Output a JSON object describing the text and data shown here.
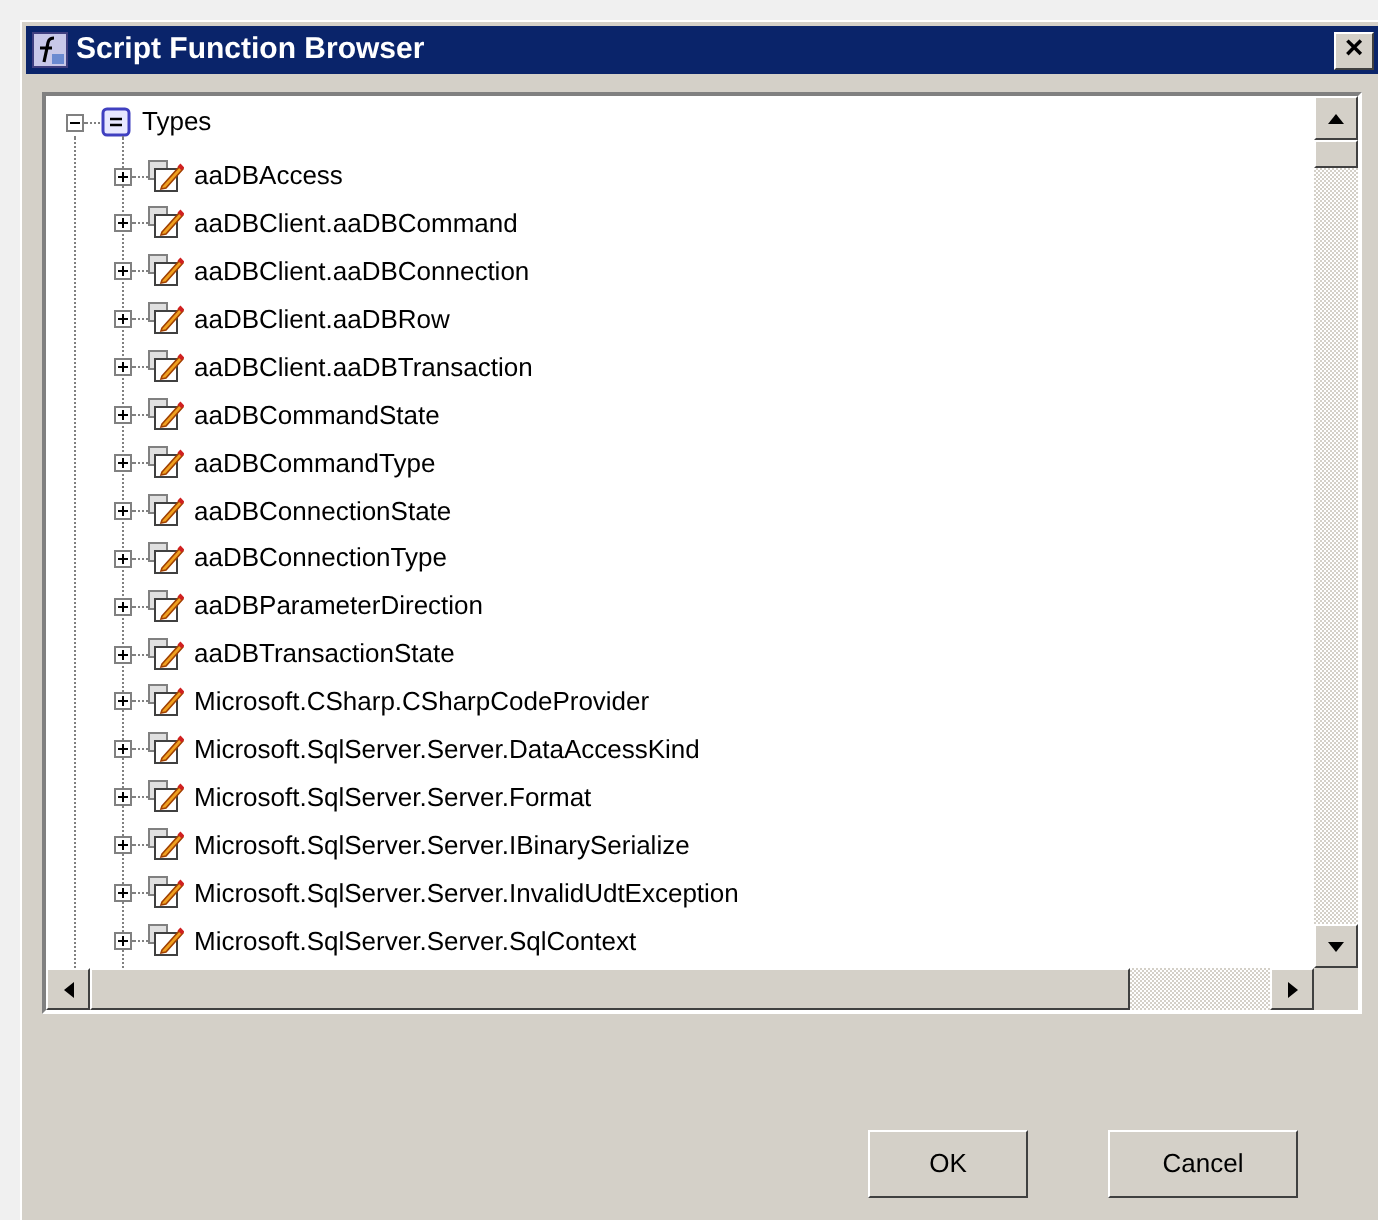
{
  "window": {
    "title": "Script Function Browser",
    "close": "×"
  },
  "tree": [
    {
      "label": "Types",
      "expanded": true,
      "children": [
        {
          "label": "aaDBAccess",
          "expanded": false
        },
        {
          "label": "aaDBClient.aaDBCommand",
          "expanded": false
        },
        {
          "label": "aaDBClient.aaDBConnection",
          "expanded": false
        },
        {
          "label": "aaDBClient.aaDBRow",
          "expanded": false
        },
        {
          "label": "aaDBClient.aaDBTransaction",
          "expanded": false
        },
        {
          "label": "aaDBCommandState",
          "expanded": false
        },
        {
          "label": "aaDBCommandType",
          "expanded": false
        },
        {
          "label": "aaDBConnectionState",
          "expanded": false
        },
        {
          "label": "aaDBConnectionType",
          "expanded": false
        },
        {
          "label": "aaDBParameterDirection",
          "expanded": false
        },
        {
          "label": "aaDBTransactionState",
          "expanded": false
        },
        {
          "label": "Microsoft.CSharp.CSharpCodeProvider",
          "expanded": false
        },
        {
          "label": "Microsoft.SqlServer.Server.DataAccessKind",
          "expanded": false
        },
        {
          "label": "Microsoft.SqlServer.Server.Format",
          "expanded": false
        },
        {
          "label": "Microsoft.SqlServer.Server.IBinarySerialize",
          "expanded": false
        },
        {
          "label": "Microsoft.SqlServer.Server.InvalidUdtException",
          "expanded": false
        },
        {
          "label": "Microsoft.SqlServer.Server.SqlContext",
          "expanded": false
        }
      ]
    }
  ],
  "buttons": [
    "OK",
    "Cancel"
  ]
}
